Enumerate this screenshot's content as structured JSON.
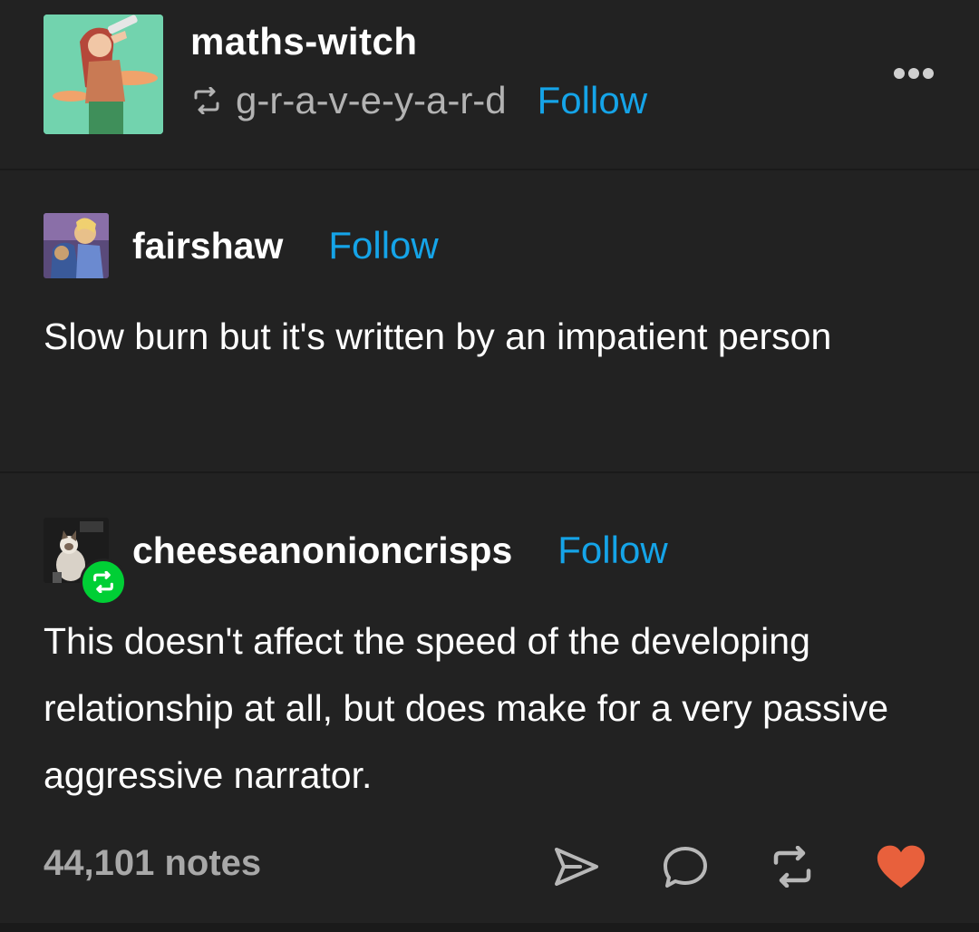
{
  "header": {
    "username": "maths-witch",
    "reblogged_from": "g-r-a-v-e-y-a-r-d",
    "follow_label": "Follow"
  },
  "posts": [
    {
      "username": "fairshaw",
      "follow_label": "Follow",
      "body": "Slow burn but it's written by an impatient person"
    },
    {
      "username": "cheeseanonioncrisps",
      "follow_label": "Follow",
      "body": "This doesn't affect the speed of the developing relationship at all, but does make for a very passive aggressive narrator."
    }
  ],
  "footer": {
    "notes": "44,101 notes"
  },
  "colors": {
    "background": "#222222",
    "follow": "#15a4e8",
    "like": "#e8603c",
    "reblog_badge": "#00cf35"
  },
  "icons": [
    "reblog-icon",
    "more-icon",
    "share-icon",
    "comment-icon",
    "reblog-icon",
    "heart-icon"
  ]
}
